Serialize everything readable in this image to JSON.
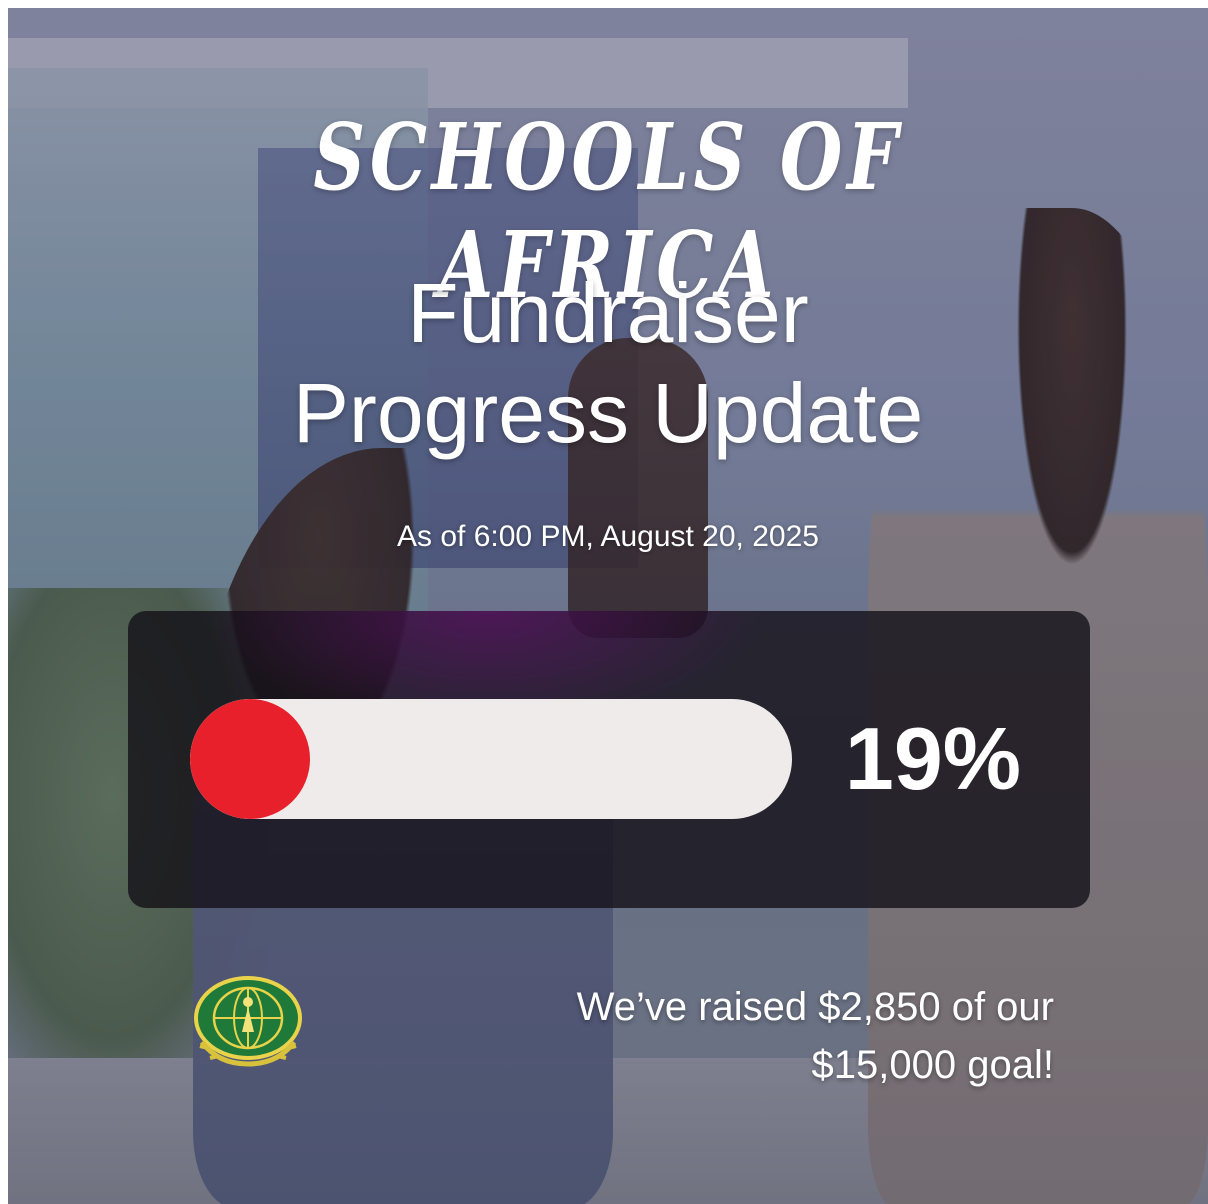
{
  "header": {
    "title": "SCHOOLS OF AFRICA",
    "subtitle_line1": "Fundraiser",
    "subtitle_line2": "Progress Update",
    "as_of": "As of 6:00 PM, August 20, 2025"
  },
  "progress": {
    "percent_label": "19%",
    "fraction": 0.19,
    "fill_color": "#e8202b",
    "track_color": "#efebea"
  },
  "footer": {
    "raised_line1": "We’ve raised $2,850 of our",
    "raised_line2": "$15,000 goal!"
  },
  "logo": {
    "icon": "laurel-globe-emblem-icon"
  }
}
